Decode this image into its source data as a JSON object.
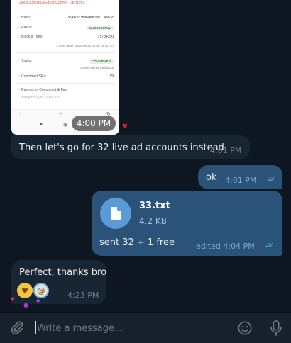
{
  "screenshot_card": {
    "top_link": "TJ6XxLsJqZRoJvEdS9hL3efhm....dcYr95X",
    "rows": [
      {
        "label": "Hash:",
        "value": "354f26c3896ded7f9f....4383c"
      },
      {
        "label": "Result:",
        "value": "SUCCESSFUL"
      },
      {
        "label": "Block & Time:",
        "value": "75784350"
      },
      {
        "label": "Status:",
        "value": "CONFIRMED"
      },
      {
        "label": "Confirmed SRs:",
        "value": "19"
      },
      {
        "label": "Resources Consumed & Fee:",
        "value": ""
      }
    ],
    "block_time_sub": "3 mins ago | 2025-09-16 08:56:15 (UTC)",
    "confirmed_sub": "Confirmed by 69 blocks",
    "fee_sub": "Energy Fee (Unit: 13.344 TRX",
    "time": "4:00 PM"
  },
  "messages": [
    {
      "text": "Then let's go for 32 live ad accounts instead",
      "time": "4:01 PM"
    },
    {
      "text": "ok",
      "time": "4:01 PM"
    },
    {
      "file_name": "33.txt",
      "file_size": "4.2 KB",
      "text": "sent 32 + 1 free",
      "time": "edited 4:04 PM"
    },
    {
      "text": "Perfect, thanks bro",
      "time": "4:23 PM"
    }
  ],
  "composer": {
    "placeholder": "Write a message..."
  },
  "colors": {
    "background": "#0e1621",
    "incoming": "#182533",
    "outgoing": "#2b5278",
    "accent": "#6ab3f3"
  },
  "icons": [
    "paperclip-icon",
    "emoji-icon",
    "microphone-icon",
    "file-icon",
    "double-check-icon",
    "heart-icon"
  ]
}
